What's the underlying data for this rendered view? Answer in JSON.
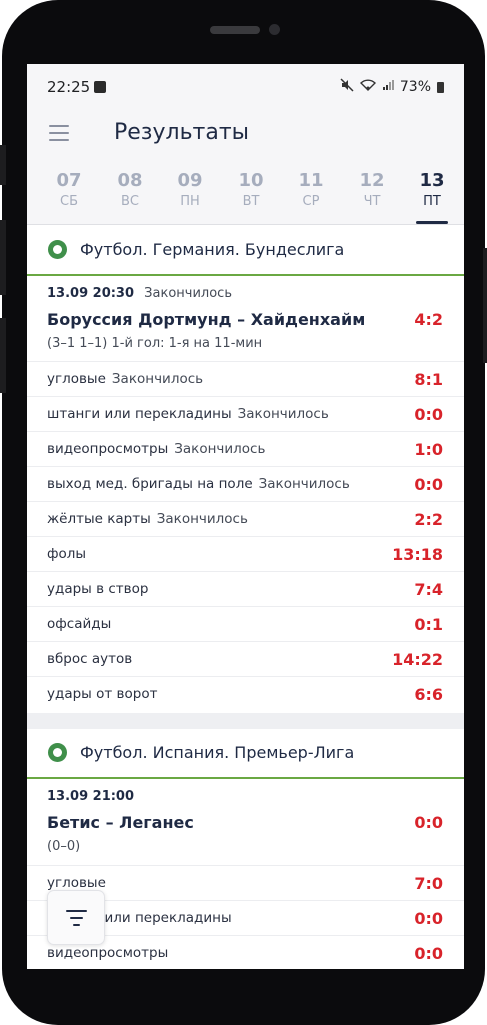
{
  "status_bar": {
    "time": "22:25",
    "battery": "73%"
  },
  "header": {
    "title": "Результаты"
  },
  "dates": [
    {
      "num": "07",
      "dow": "СБ"
    },
    {
      "num": "08",
      "dow": "ВС"
    },
    {
      "num": "09",
      "dow": "ПН"
    },
    {
      "num": "10",
      "dow": "ВТ"
    },
    {
      "num": "11",
      "dow": "СР"
    },
    {
      "num": "12",
      "dow": "ЧТ"
    },
    {
      "num": "13",
      "dow": "ПТ"
    }
  ],
  "leagues": [
    {
      "name": "Футбол. Германия. Бундеслига",
      "match": {
        "datetime": "13.09 20:30",
        "status": "Закончилось",
        "teams": "Боруссия Дортмунд – Хайденхайм",
        "score": "4:2",
        "detail": "(3–1 1–1) 1-й гол: 1-я на 11-мин"
      },
      "stats": [
        {
          "label": "угловые",
          "status": "Закончилось",
          "value": "8:1"
        },
        {
          "label": "штанги или перекладины",
          "status": "Закончилось",
          "value": "0:0"
        },
        {
          "label": "видеопросмотры",
          "status": "Закончилось",
          "value": "1:0"
        },
        {
          "label": "выход мед. бригады на поле",
          "status": "Закончилось",
          "value": "0:0"
        },
        {
          "label": "жёлтые карты",
          "status": "Закончилось",
          "value": "2:2"
        },
        {
          "label": "фолы",
          "status": "",
          "value": "13:18"
        },
        {
          "label": "удары в створ",
          "status": "",
          "value": "7:4"
        },
        {
          "label": "офсайды",
          "status": "",
          "value": "0:1"
        },
        {
          "label": "вброс аутов",
          "status": "",
          "value": "14:22"
        },
        {
          "label": "удары от ворот",
          "status": "",
          "value": "6:6"
        }
      ]
    },
    {
      "name": "Футбол. Испания. Премьер-Лига",
      "match": {
        "datetime": "13.09 21:00",
        "status": "",
        "teams": "Бетис – Леганес",
        "score": "0:0",
        "detail": "(0–0)"
      },
      "stats": [
        {
          "label": "угловые",
          "status": "",
          "value": "7:0"
        },
        {
          "label": "штанги или перекладины",
          "status": "",
          "value": "0:0"
        },
        {
          "label": "видеопросмотры",
          "status": "",
          "value": "0:0"
        }
      ]
    }
  ],
  "colors": {
    "accent": "#1f2a44",
    "score": "#d8232a",
    "league_line": "#6aa843"
  }
}
